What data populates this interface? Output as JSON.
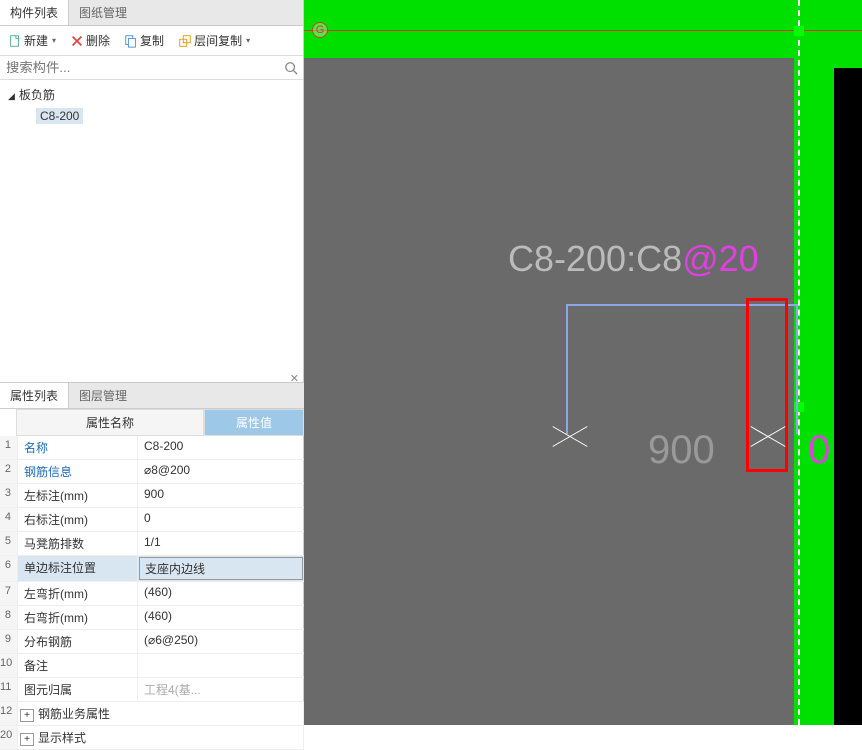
{
  "tabs": {
    "component_list": "构件列表",
    "drawing_mgmt": "图纸管理"
  },
  "toolbar": {
    "new": "新建",
    "delete": "删除",
    "copy": "复制",
    "floor_copy": "层间复制"
  },
  "search": {
    "placeholder": "搜索构件...",
    "icon_glyph": "🔍"
  },
  "tree": {
    "root": "板负筋",
    "child": "C8-200"
  },
  "bottom_tabs": {
    "prop_list": "属性列表",
    "layer_mgmt": "图层管理"
  },
  "prop_header": {
    "name": "属性名称",
    "value": "属性值"
  },
  "props": [
    {
      "n": "1",
      "name": "名称",
      "value": "C8-200",
      "link": true
    },
    {
      "n": "2",
      "name": "钢筋信息",
      "value": "⌀8@200",
      "link": true
    },
    {
      "n": "3",
      "name": "左标注(mm)",
      "value": "900"
    },
    {
      "n": "4",
      "name": "右标注(mm)",
      "value": "0"
    },
    {
      "n": "5",
      "name": "马凳筋排数",
      "value": "1/1"
    },
    {
      "n": "6",
      "name": "单边标注位置",
      "value": "支座内边线",
      "selected": true,
      "boxed": true
    },
    {
      "n": "7",
      "name": "左弯折(mm)",
      "value": "(460)"
    },
    {
      "n": "8",
      "name": "右弯折(mm)",
      "value": "(460)"
    },
    {
      "n": "9",
      "name": "分布钢筋",
      "value": "(⌀6@250)"
    },
    {
      "n": "10",
      "name": "备注",
      "value": ""
    },
    {
      "n": "11",
      "name": "图元归属",
      "value": "工程4(基...",
      "muted": true
    }
  ],
  "prop_groups": [
    {
      "n": "12",
      "name": "钢筋业务属性"
    },
    {
      "n": "20",
      "name": "显示样式"
    }
  ],
  "canvas": {
    "axis_marker": "G",
    "label_main_1": "C8-200:C8",
    "label_main_2": "@",
    "label_main_3": "20",
    "dim_left": "900",
    "dim_right": "0"
  },
  "chart_data": {
    "type": "table",
    "title": "板负筋 C8-200 属性",
    "rows": [
      [
        "名称",
        "C8-200"
      ],
      [
        "钢筋信息",
        "⌀8@200"
      ],
      [
        "左标注(mm)",
        "900"
      ],
      [
        "右标注(mm)",
        "0"
      ],
      [
        "马凳筋排数",
        "1/1"
      ],
      [
        "单边标注位置",
        "支座内边线"
      ],
      [
        "左弯折(mm)",
        "(460)"
      ],
      [
        "右弯折(mm)",
        "(460)"
      ],
      [
        "分布钢筋",
        "(⌀6@250)"
      ],
      [
        "备注",
        ""
      ],
      [
        "图元归属",
        "工程4(基...)"
      ]
    ]
  }
}
